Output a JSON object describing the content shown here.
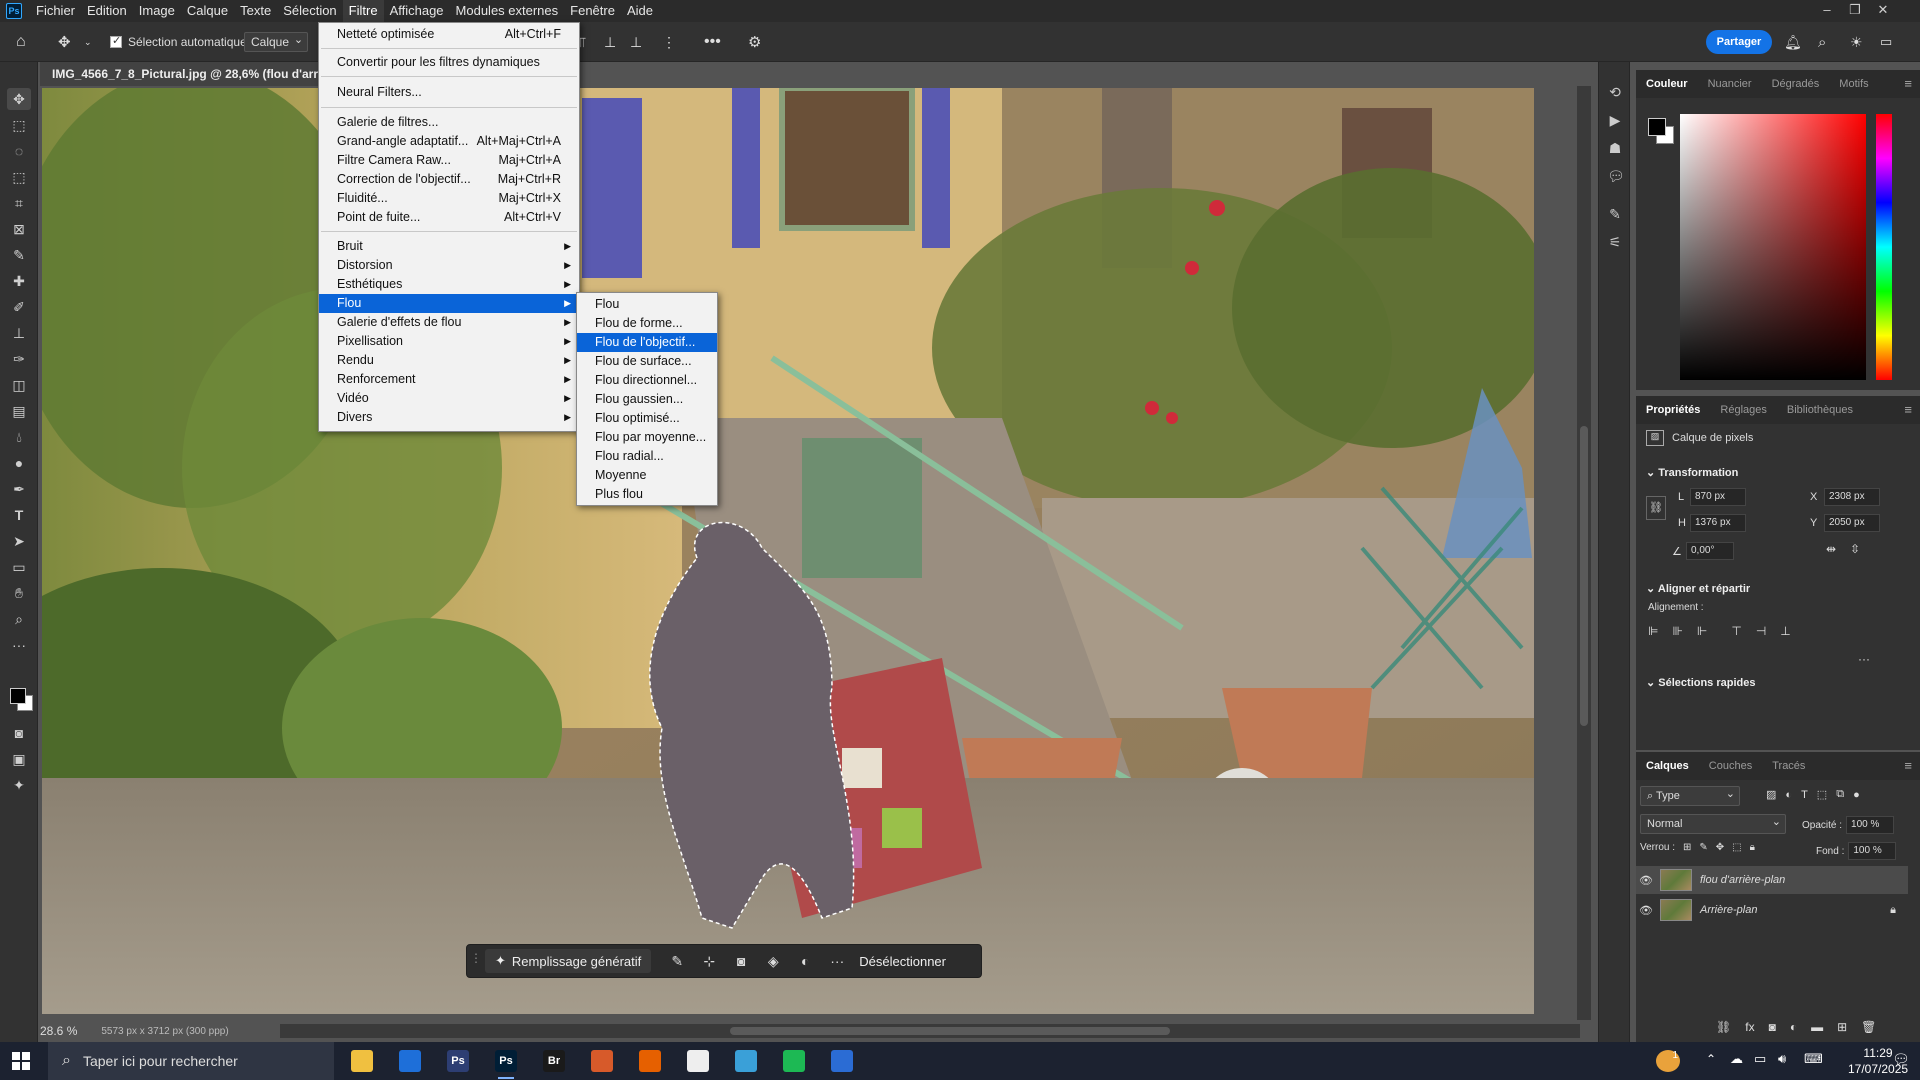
{
  "menubar": {
    "logo": "Ps",
    "items": [
      "Fichier",
      "Edition",
      "Image",
      "Calque",
      "Texte",
      "Sélection",
      "Filtre",
      "Affichage",
      "Modules externes",
      "Fenêtre",
      "Aide"
    ],
    "active": "Filtre"
  },
  "options": {
    "auto_select_label": "Sélection automatique :",
    "auto_select_checked": true,
    "layer_select": "Calque",
    "share_label": "Partager"
  },
  "document": {
    "tab_title": "IMG_4566_7_8_Pictural.jpg @ 28,6% (flou d'arrière-",
    "zoom": "28.6 %",
    "dimensions": "5573 px x 3712 px (300 ppp)"
  },
  "filter_menu": {
    "items": [
      {
        "label": "Netteté optimisée",
        "shortcut": "Alt+Ctrl+F"
      },
      {
        "label": "Convertir pour les filtres dynamiques",
        "shortcut": ""
      },
      {
        "label": "Neural Filters...",
        "shortcut": ""
      },
      {
        "label": "Galerie de filtres...",
        "shortcut": ""
      },
      {
        "label": "Grand-angle adaptatif...",
        "shortcut": "Alt+Maj+Ctrl+A"
      },
      {
        "label": "Filtre Camera Raw...",
        "shortcut": "Maj+Ctrl+A"
      },
      {
        "label": "Correction de l'objectif...",
        "shortcut": "Maj+Ctrl+R"
      },
      {
        "label": "Fluidité...",
        "shortcut": "Maj+Ctrl+X"
      },
      {
        "label": "Point de fuite...",
        "shortcut": "Alt+Ctrl+V"
      },
      {
        "label": "Bruit",
        "shortcut": ""
      },
      {
        "label": "Distorsion",
        "shortcut": ""
      },
      {
        "label": "Esthétiques",
        "shortcut": ""
      },
      {
        "label": "Flou",
        "shortcut": ""
      },
      {
        "label": "Galerie d'effets de flou",
        "shortcut": ""
      },
      {
        "label": "Pixellisation",
        "shortcut": ""
      },
      {
        "label": "Rendu",
        "shortcut": ""
      },
      {
        "label": "Renforcement",
        "shortcut": ""
      },
      {
        "label": "Vidéo",
        "shortcut": ""
      },
      {
        "label": "Divers",
        "shortcut": ""
      }
    ]
  },
  "blur_submenu": {
    "items": [
      "Flou",
      "Flou de forme...",
      "Flou de l'objectif...",
      "Flou de surface...",
      "Flou directionnel...",
      "Flou gaussien...",
      "Flou optimisé...",
      "Flou par moyenne...",
      "Flou radial...",
      "Moyenne",
      "Plus flou"
    ],
    "highlighted": "Flou de l'objectif..."
  },
  "context_bar": {
    "generative_fill": "Remplissage génératif",
    "deselect": "Désélectionner"
  },
  "color_panel": {
    "tabs": [
      "Couleur",
      "Nuancier",
      "Dégradés",
      "Motifs"
    ],
    "fg_color": "#000000",
    "bg_color": "#ffffff"
  },
  "properties_panel": {
    "tabs": [
      "Propriétés",
      "Réglages",
      "Bibliothèques"
    ],
    "layer_kind": "Calque de pixels",
    "transform_title": "Transformation",
    "w_label": "L",
    "w": "870 px",
    "h_label": "H",
    "h": "1376 px",
    "x_label": "X",
    "x": "2308 px",
    "y_label": "Y",
    "y": "2050 px",
    "angle": "0,00°",
    "align_title": "Aligner et répartir",
    "align_label": "Alignement :",
    "quick_title": "Sélections rapides"
  },
  "layers_panel": {
    "tabs": [
      "Calques",
      "Couches",
      "Tracés"
    ],
    "filter": "Type",
    "blend": "Normal",
    "opacity_label": "Opacité :",
    "opacity": "100 %",
    "lock_label": "Verrou :",
    "fill_label": "Fond :",
    "fill": "100 %",
    "layers": [
      {
        "name": "flou d'arrière-plan",
        "selected": true,
        "locked": false
      },
      {
        "name": "Arrière-plan",
        "selected": false,
        "locked": true
      }
    ]
  },
  "taskbar": {
    "search_placeholder": "Taper ici pour rechercher",
    "time": "11:29",
    "date": "17/07/2025",
    "notif_count": "1",
    "apps": [
      {
        "icon": "file-explorer-icon",
        "label": "",
        "color": "#f0c040"
      },
      {
        "icon": "store-icon",
        "label": "",
        "color": "#1e6fd9"
      },
      {
        "icon": "photoshop-icon",
        "label": "Ps",
        "color": "#2d3e73"
      },
      {
        "icon": "photoshop-active-icon",
        "label": "Ps",
        "color": "#001e36"
      },
      {
        "icon": "bridge-icon",
        "label": "Br",
        "color": "#1a1a1a"
      },
      {
        "icon": "pictural-icon",
        "label": "",
        "color": "#d75a2a"
      },
      {
        "icon": "firefox-icon",
        "label": "",
        "color": "#e66000"
      },
      {
        "icon": "notepad-icon",
        "label": "",
        "color": "#eeeeee"
      },
      {
        "icon": "photo-app-icon",
        "label": "",
        "color": "#3aa0d8"
      },
      {
        "icon": "spotify-icon",
        "label": "",
        "color": "#1db954"
      },
      {
        "icon": "word-icon",
        "label": "",
        "color": "#2b6cd4"
      }
    ]
  }
}
